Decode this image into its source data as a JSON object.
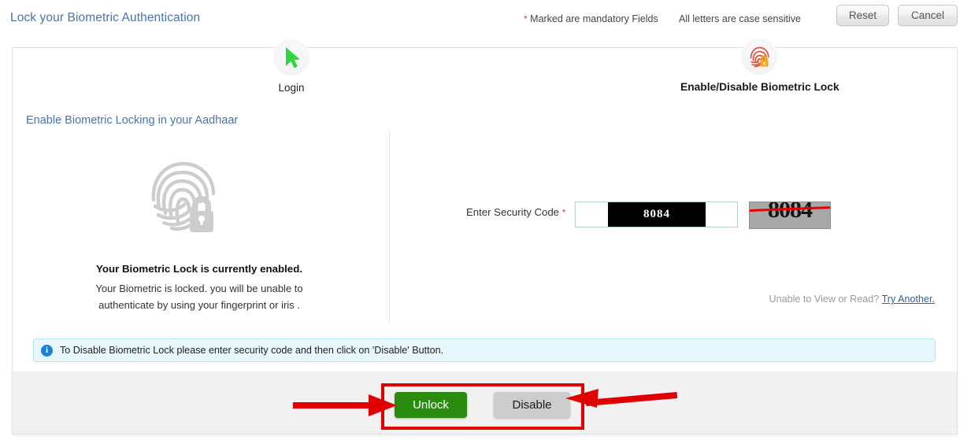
{
  "header": {
    "title": "Lock your Biometric Authentication",
    "mandatory_note": "Marked are mandatory Fields",
    "mandatory_star": "*",
    "case_note": "All letters are case sensitive",
    "reset_label": "Reset",
    "cancel_label": "Cancel"
  },
  "steps": [
    {
      "id": "login",
      "label": "Login",
      "icon": "cursor-arrow-icon",
      "color": "#2fd63f"
    },
    {
      "id": "biometric",
      "label": "Enable/Disable Biometric Lock",
      "icon": "fingerprint-lock-icon",
      "color": "#e0503f"
    }
  ],
  "left": {
    "heading": "Enable Biometric Locking in your Aadhaar",
    "illustration_icon": "fingerprint-lock-icon",
    "status_title": "Your Biometric Lock is currently enabled.",
    "status_desc_line1": "Your Biometric is locked. you will be unable to",
    "status_desc_line2": "authenticate by using your fingerprint or iris ."
  },
  "right": {
    "security_code_label": "Enter Security Code",
    "security_code_star": "*",
    "security_code_value": "8084",
    "security_code_placeholder": "",
    "captcha_text": "8084",
    "retry_prefix": "Unable to View or Read?",
    "retry_link": "Try Another."
  },
  "info": {
    "icon": "info-circle-icon",
    "icon_glyph": "i",
    "message": "To Disable Biometric Lock please enter security code and then click on 'Disable' Button."
  },
  "footer": {
    "unlock_label": "Unlock",
    "disable_label": "Disable",
    "unlock_color": "#2a8c0e",
    "disable_color": "#cccccc"
  },
  "annotations": {
    "highlight_color": "#e00000",
    "arrow_left_target": "Unlock",
    "arrow_right_target": "Disable"
  }
}
